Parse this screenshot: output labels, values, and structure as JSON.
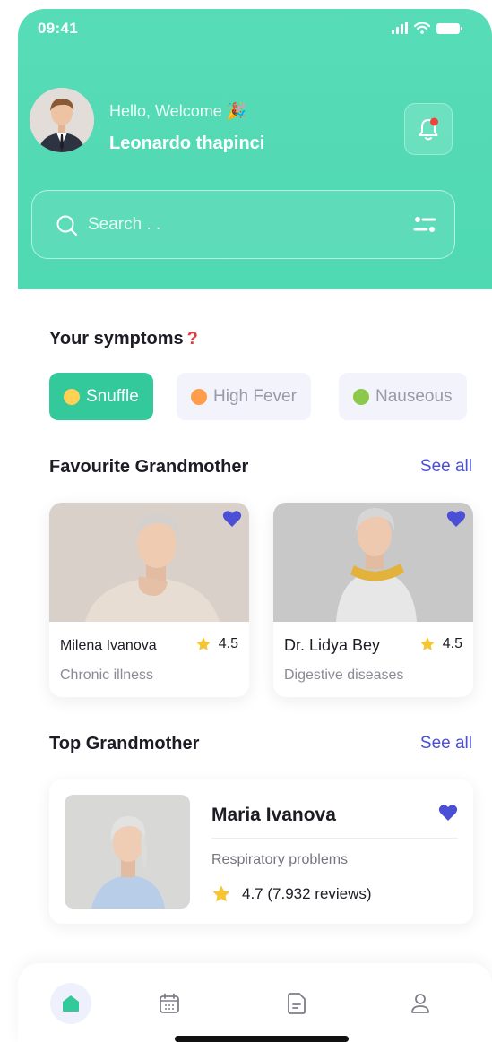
{
  "status_bar": {
    "time": "09:41"
  },
  "header": {
    "greeting": "Hello, Welcome 🎉",
    "user_name": "Leonardo thapinci"
  },
  "search": {
    "placeholder": "Search . ."
  },
  "symptoms": {
    "title": "Your symptoms",
    "title_mark": "?",
    "chips": [
      {
        "label": "Snuffle",
        "active": true
      },
      {
        "label": "High Fever",
        "active": false
      },
      {
        "label": "Nauseous",
        "active": false
      }
    ]
  },
  "favourite": {
    "title": "Favourite Grandmother",
    "see_all": "See all",
    "cards": [
      {
        "name": "Milena Ivanova",
        "rating": "4.5",
        "specialty": "Chronic illness"
      },
      {
        "name": "Dr. Lidya Bey",
        "rating": "4.5",
        "specialty": "Digestive diseases"
      }
    ]
  },
  "top": {
    "title": "Top Grandmother",
    "see_all": "See all",
    "card": {
      "name": "Maria Ivanova",
      "specialty": "Respiratory problems",
      "rating": "4.7 (7.932 reviews)"
    }
  },
  "colors": {
    "accent": "#4fd9b2",
    "chip_active": "#33c99b",
    "link": "#4a4fd6",
    "heart": "#4a4fd6",
    "star": "#f7c531",
    "notify_dot": "#e8453c"
  },
  "bottom_nav": [
    {
      "icon": "home-icon",
      "active": true
    },
    {
      "icon": "calendar-icon",
      "active": false
    },
    {
      "icon": "document-icon",
      "active": false
    },
    {
      "icon": "profile-icon",
      "active": false
    }
  ]
}
